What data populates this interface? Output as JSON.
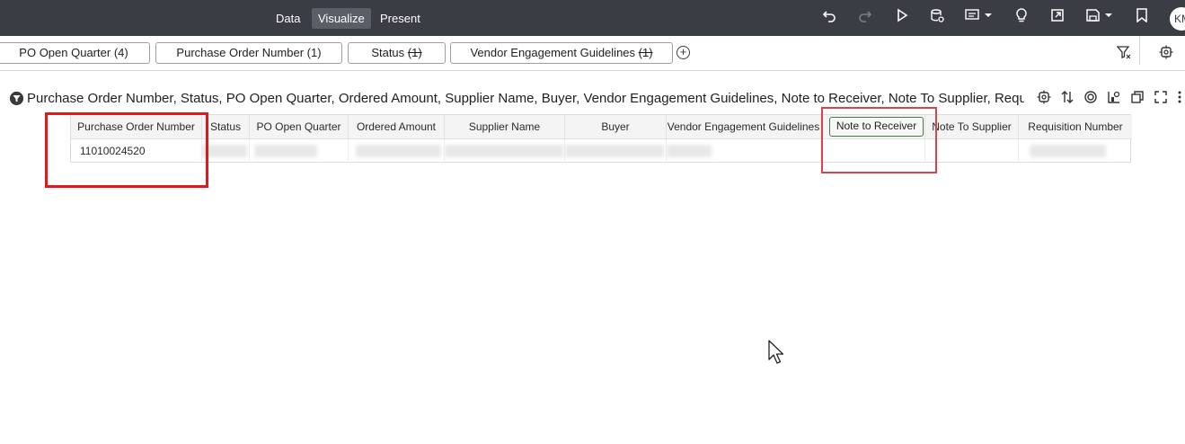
{
  "topbar": {
    "tabs": [
      {
        "label": "Data",
        "active": false
      },
      {
        "label": "Visualize",
        "active": true
      },
      {
        "label": "Present",
        "active": false
      }
    ],
    "icons": [
      "undo-icon",
      "redo-icon",
      "run-icon",
      "refresh-data-icon",
      "comment-icon",
      "insights-icon",
      "export-icon",
      "save-icon",
      "bookmark-icon"
    ],
    "avatar_initials": "KM"
  },
  "filters": {
    "pills": [
      {
        "label": "PO Open Quarter",
        "count": "(4)",
        "strike": false
      },
      {
        "label": "Purchase Order Number",
        "count": "(1)",
        "strike": false
      },
      {
        "label": "Status",
        "count": "(1)",
        "strike": true
      },
      {
        "label": "Vendor Engagement Guidelines",
        "count": "(1)",
        "strike": true
      }
    ],
    "add_symbol": "+"
  },
  "viz": {
    "title": "Purchase Order Number, Status, PO Open Quarter, Ordered Amount, Supplier Name, Buyer, Vendor Engagement Guidelines, Note to Receiver, Note To Supplier, Requisiti…"
  },
  "table": {
    "columns": [
      "Purchase Order Number",
      "Status",
      "PO Open Quarter",
      "Ordered Amount",
      "Supplier Name",
      "Buyer",
      "Vendor Engagement Guidelines",
      "Note to Receiver",
      "Note To Supplier",
      "Requisition Number"
    ],
    "rows": [
      {
        "purchase_order_number": "11010024520"
      }
    ]
  },
  "colors": {
    "topbar_bg": "#3a3d44",
    "highlight_red": "#e2181b",
    "highlight_pink": "#d9434a",
    "selected_header_border": "#4b7a3e"
  }
}
